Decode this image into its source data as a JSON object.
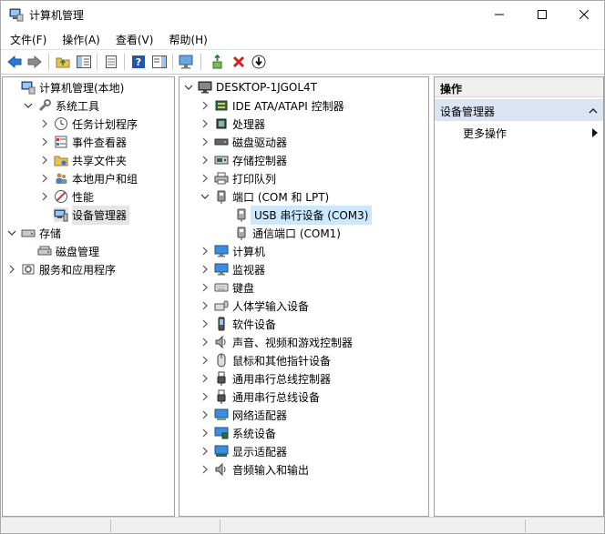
{
  "window": {
    "title": "计算机管理"
  },
  "menu": [
    "文件(F)",
    "操作(A)",
    "查看(V)",
    "帮助(H)"
  ],
  "left_tree": [
    {
      "label": "计算机管理(本地)",
      "level": 0,
      "icon": "computer-management-icon",
      "chev": "none"
    },
    {
      "label": "系统工具",
      "level": 1,
      "icon": "tools-icon",
      "chev": "down"
    },
    {
      "label": "任务计划程序",
      "level": 2,
      "icon": "clock-icon",
      "chev": "right"
    },
    {
      "label": "事件查看器",
      "level": 2,
      "icon": "event-viewer-icon",
      "chev": "right"
    },
    {
      "label": "共享文件夹",
      "level": 2,
      "icon": "shared-folder-icon",
      "chev": "right"
    },
    {
      "label": "本地用户和组",
      "level": 2,
      "icon": "users-icon",
      "chev": "right"
    },
    {
      "label": "性能",
      "level": 2,
      "icon": "performance-icon",
      "chev": "right"
    },
    {
      "label": "设备管理器",
      "level": 2,
      "icon": "device-manager-icon",
      "chev": "none",
      "selected": true
    },
    {
      "label": "存储",
      "level": 0,
      "icon": "storage-icon",
      "chev": "down"
    },
    {
      "label": "磁盘管理",
      "level": 1,
      "icon": "disk-management-icon",
      "chev": "none"
    },
    {
      "label": "服务和应用程序",
      "level": 0,
      "icon": "services-icon",
      "chev": "right"
    }
  ],
  "device_tree": {
    "root": "DESKTOP-1JGOL4T",
    "items": [
      {
        "label": "IDE ATA/ATAPI 控制器",
        "icon": "ide-controller-icon",
        "expanded": false
      },
      {
        "label": "处理器",
        "icon": "processor-icon",
        "expanded": false
      },
      {
        "label": "磁盘驱动器",
        "icon": "disk-drive-icon",
        "expanded": false
      },
      {
        "label": "存储控制器",
        "icon": "storage-controller-icon",
        "expanded": false
      },
      {
        "label": "打印队列",
        "icon": "printer-icon",
        "expanded": false
      },
      {
        "label": "端口 (COM 和 LPT)",
        "icon": "port-icon",
        "expanded": true,
        "children": [
          {
            "label": "USB 串行设备 (COM3)",
            "icon": "serial-port-icon",
            "selected": true
          },
          {
            "label": "通信端口 (COM1)",
            "icon": "serial-port-icon"
          }
        ]
      },
      {
        "label": "计算机",
        "icon": "monitor-icon",
        "expanded": false
      },
      {
        "label": "监视器",
        "icon": "monitor-icon",
        "expanded": false
      },
      {
        "label": "键盘",
        "icon": "keyboard-icon",
        "expanded": false
      },
      {
        "label": "人体学输入设备",
        "icon": "hid-icon",
        "expanded": false
      },
      {
        "label": "软件设备",
        "icon": "software-device-icon",
        "expanded": false
      },
      {
        "label": "声音、视频和游戏控制器",
        "icon": "speaker-icon",
        "expanded": false
      },
      {
        "label": "鼠标和其他指针设备",
        "icon": "mouse-icon",
        "expanded": false
      },
      {
        "label": "通用串行总线控制器",
        "icon": "usb-icon",
        "expanded": false
      },
      {
        "label": "通用串行总线设备",
        "icon": "usb-icon",
        "expanded": false
      },
      {
        "label": "网络适配器",
        "icon": "network-adapter-icon",
        "expanded": false
      },
      {
        "label": "系统设备",
        "icon": "system-device-icon",
        "expanded": false
      },
      {
        "label": "显示适配器",
        "icon": "display-adapter-icon",
        "expanded": false
      },
      {
        "label": "音频输入和输出",
        "icon": "speaker-icon",
        "expanded": false
      }
    ]
  },
  "actions": {
    "header": "操作",
    "section": "设备管理器",
    "more": "更多操作"
  }
}
